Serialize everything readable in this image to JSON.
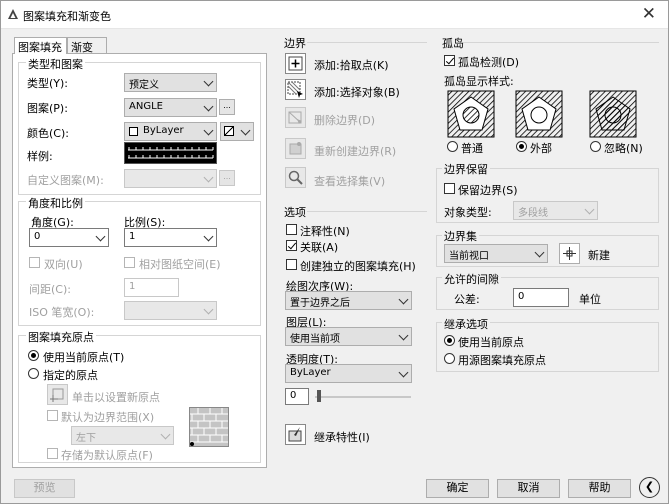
{
  "window": {
    "title": "图案填充和渐变色",
    "close_glyph": "✕"
  },
  "tabs": [
    "图案填充",
    "渐变色"
  ],
  "type_pattern": {
    "title": "类型和图案",
    "type_label": "类型(Y):",
    "type_value": "预定义",
    "pattern_label": "图案(P):",
    "pattern_value": "ANGLE",
    "pattern_browse": "...",
    "color_label": "颜色(C):",
    "color_value": "ByLayer",
    "swatch_label": "样例:",
    "custom_label": "自定义图案(M):",
    "custom_browse": "..."
  },
  "angle_scale": {
    "title": "角度和比例",
    "angle_label": "角度(G):",
    "angle_value": "0",
    "scale_label": "比例(S):",
    "scale_value": "1",
    "double_label": "双向(U)",
    "relative_label": "相对图纸空间(E)",
    "spacing_label": "间距(C):",
    "spacing_value": "1",
    "iso_label": "ISO 笔宽(O):"
  },
  "origin": {
    "title": "图案填充原点",
    "use_current": "使用当前原点(T)",
    "specified": "指定的原点",
    "click_set": "单击以设置新原点",
    "default_extent": "默认为边界范围(X)",
    "position_value": "左下",
    "store_default": "存储为默认原点(F)"
  },
  "boundary": {
    "title": "边界",
    "add_pick": "添加:拾取点(K)",
    "add_select": "添加:选择对象(B)",
    "remove": "删除边界(D)",
    "recreate": "重新创建边界(R)",
    "view": "查看选择集(V)"
  },
  "options": {
    "title": "选项",
    "annotative": "注释性(N)",
    "associative": "关联(A)",
    "separate": "创建独立的图案填充(H)",
    "draw_order_label": "绘图次序(W):",
    "draw_order_value": "置于边界之后",
    "layer_label": "图层(L):",
    "layer_value": "使用当前项",
    "transparency_label": "透明度(T):",
    "transparency_value": "ByLayer",
    "transparency_number": "0"
  },
  "inherit": {
    "label": "继承特性(I)"
  },
  "islands": {
    "title": "孤岛",
    "detect": "孤岛检测(D)",
    "style_label": "孤岛显示样式:",
    "normal": "普通",
    "outer": "外部",
    "ignore": "忽略(N)"
  },
  "retain": {
    "title": "边界保留",
    "retain_label": "保留边界(S)",
    "object_type_label": "对象类型:",
    "object_type_value": "多段线"
  },
  "boundary_set": {
    "title": "边界集",
    "value": "当前视口",
    "new_label": "新建"
  },
  "gap": {
    "title": "允许的间隙",
    "tolerance_label": "公差:",
    "tolerance_value": "0",
    "unit": "单位"
  },
  "inherit_opts": {
    "title": "继承选项",
    "use_current": "使用当前原点",
    "use_source": "用源图案填充原点"
  },
  "footer": {
    "preview": "预览",
    "ok": "确定",
    "cancel": "取消",
    "help": "帮助",
    "collapse_glyph": "❮"
  }
}
